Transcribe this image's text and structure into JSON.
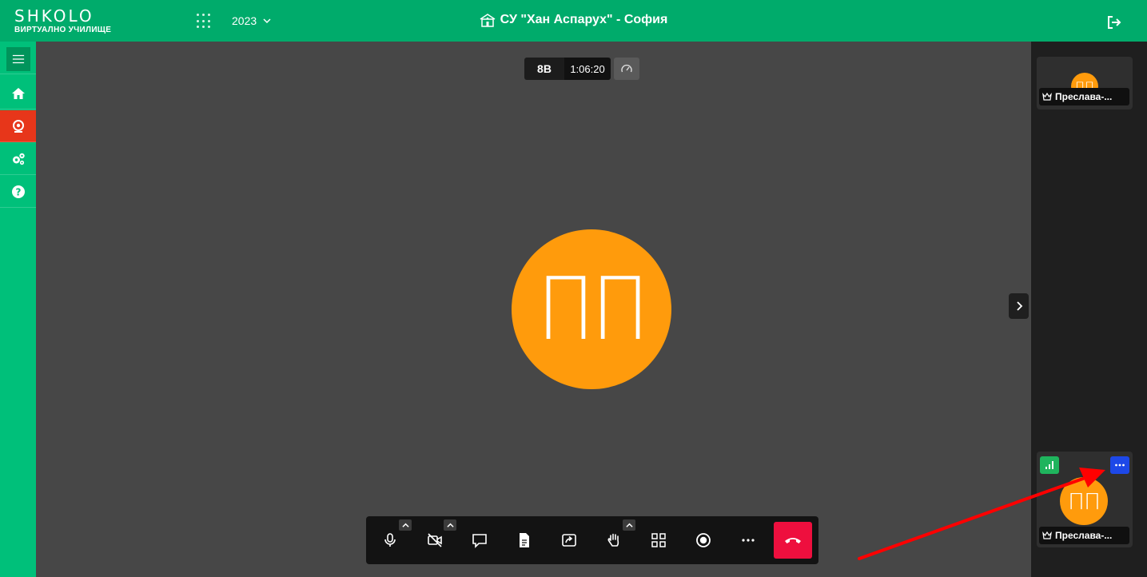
{
  "header": {
    "logo_text": "SHKOLO",
    "logo_subtitle": "ВИРТУАЛНО УЧИЛИЩЕ",
    "apps_icon": "apps-grid-icon",
    "year": "2023",
    "school_name": "СУ \"Хан Аспарух\" - София",
    "school_icon": "school-building-icon",
    "logout_icon": "logout-icon"
  },
  "sidebar": {
    "items": [
      {
        "icon": "menu-icon"
      },
      {
        "icon": "home-icon"
      },
      {
        "icon": "webcam-icon",
        "active": true
      },
      {
        "icon": "gears-icon"
      },
      {
        "icon": "help-icon"
      }
    ]
  },
  "meeting": {
    "room_name": "8В",
    "timer": "1:06:20",
    "speaker_initials": "ПП"
  },
  "toolbar": {
    "buttons": [
      "microphone",
      "camera-off",
      "chat",
      "document",
      "share-screen",
      "raise-hand",
      "tile-view",
      "record",
      "more",
      "hang-up"
    ]
  },
  "filmstrip": {
    "participants": [
      {
        "initials": "ПП",
        "name": "Преслава-..."
      },
      {
        "initials": "ПП",
        "name": "Преслава-..."
      }
    ]
  },
  "colors": {
    "brand_green": "#00ab6b",
    "rail_green": "#00c07a",
    "active_red": "#e7361a",
    "avatar_orange": "#ff9b0c",
    "hangup_red": "#ee0f3e",
    "more_blue": "#1d48e8",
    "signal_green": "#1fb45d",
    "annotation_arrow": "#ff0000"
  }
}
